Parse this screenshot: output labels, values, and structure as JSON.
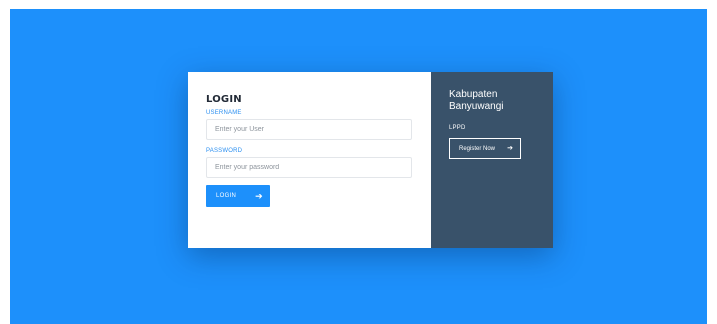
{
  "login": {
    "title": "LOGIN",
    "username_label": "USERNAME",
    "username_placeholder": "Enter your User",
    "password_label": "PASSWORD",
    "password_placeholder": "Enter your password",
    "button_label": "LOGIN",
    "button_icon": "arrow-right-icon"
  },
  "side": {
    "title": "Kabupaten Banyuwangi",
    "subtitle": "LPPD",
    "register_label": "Register Now",
    "register_icon": "arrow-right-icon"
  },
  "colors": {
    "background": "#1d90fb",
    "side_panel": "#39526a",
    "accent": "#2b8ff0"
  }
}
